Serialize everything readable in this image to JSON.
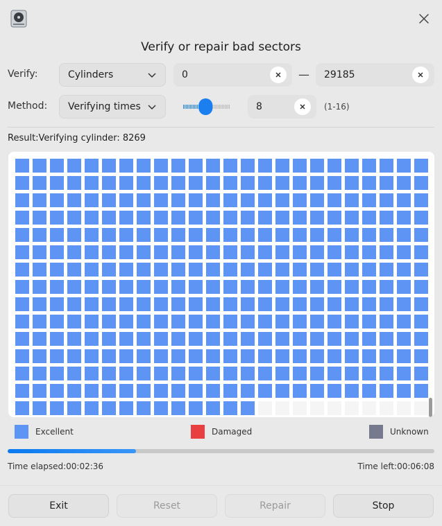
{
  "window": {
    "title": "Verify or repair bad sectors",
    "icon": "disk-icon"
  },
  "verify": {
    "label": "Verify:",
    "mode": "Cylinders",
    "from_value": "0",
    "to_value": "29185",
    "separator": "—"
  },
  "method": {
    "label": "Method:",
    "mode": "Verifying times",
    "slider_value": 8,
    "slider_min": 1,
    "slider_max": 16,
    "times_value": "8",
    "range_hint": "(1-16)"
  },
  "result": {
    "text": "Result:Verifying cylinder: 8269"
  },
  "sector_grid": {
    "columns": 24,
    "visible_rows": 15,
    "completed_cells_in_last_row": 14,
    "status_color_excellent": "#5e95f5",
    "status_color_pending": "#f5f5f5"
  },
  "legend": [
    {
      "label": "Excellent",
      "color": "#5e95f5"
    },
    {
      "label": "Damaged",
      "color": "#e84040"
    },
    {
      "label": "Unknown",
      "color": "#777a8c"
    }
  ],
  "progress": {
    "percent": 30
  },
  "time": {
    "elapsed": "Time elapsed:00:02:36",
    "left": "Time left:00:06:08"
  },
  "buttons": {
    "exit": "Exit",
    "reset": "Reset",
    "repair": "Repair",
    "stop": "Stop"
  }
}
